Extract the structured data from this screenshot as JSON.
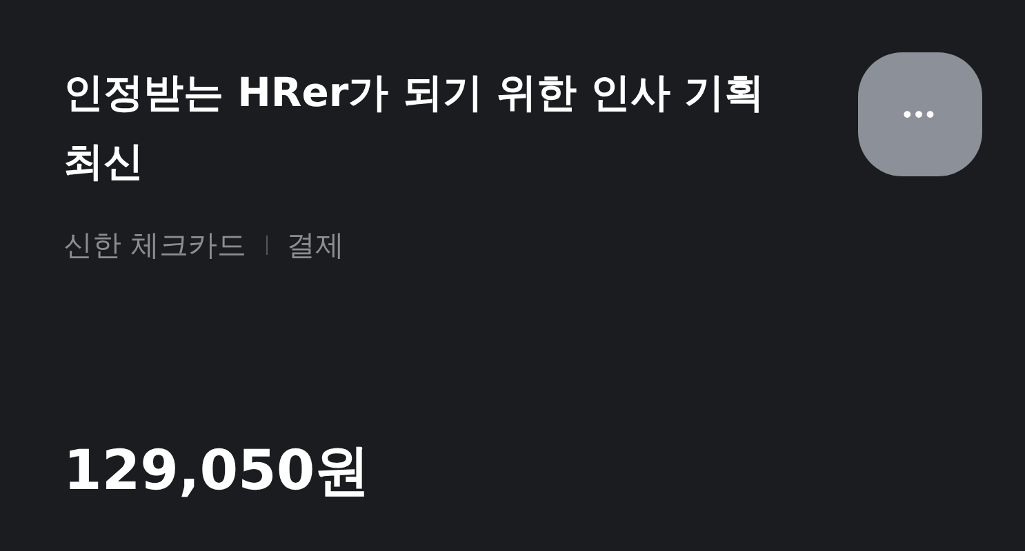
{
  "title": "인정받는 HRer가 되기 위한 인사 기획 최신",
  "more_button": {
    "label": "•••"
  },
  "meta": [
    "신한 체크카드",
    "결제"
  ],
  "amount": "129,050원"
}
